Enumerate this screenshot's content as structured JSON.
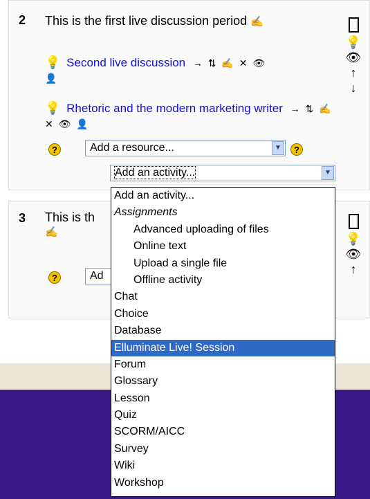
{
  "sections": [
    {
      "number": "2",
      "summary": "This is the first live discussion period",
      "summary_edit_icon": "edit-icon",
      "activities": [
        {
          "title": "Second live discussion",
          "icon": "lightbulb-icon"
        },
        {
          "title": "Rhetoric and the modern marketing writer",
          "icon": "lightbulb-icon"
        }
      ],
      "add_resource_value": "Add a resource...",
      "add_activity_value": "Add an activity..."
    },
    {
      "number": "3",
      "summary": "This is th",
      "add_resource_value": "Ad"
    }
  ],
  "dropdown_options": [
    {
      "label": "Add an activity...",
      "kind": "option"
    },
    {
      "label": "Assignments",
      "kind": "group"
    },
    {
      "label": "Advanced uploading of files",
      "kind": "indented"
    },
    {
      "label": "Online text",
      "kind": "indented"
    },
    {
      "label": "Upload a single file",
      "kind": "indented"
    },
    {
      "label": "Offline activity",
      "kind": "indented"
    },
    {
      "label": "Chat",
      "kind": "option"
    },
    {
      "label": "Choice",
      "kind": "option"
    },
    {
      "label": "Database",
      "kind": "option"
    },
    {
      "label": "Elluminate Live! Session",
      "kind": "option",
      "selected": true
    },
    {
      "label": "Forum",
      "kind": "option"
    },
    {
      "label": "Glossary",
      "kind": "option"
    },
    {
      "label": "Lesson",
      "kind": "option"
    },
    {
      "label": "Quiz",
      "kind": "option"
    },
    {
      "label": "SCORM/AICC",
      "kind": "option"
    },
    {
      "label": "Survey",
      "kind": "option"
    },
    {
      "label": "Wiki",
      "kind": "option"
    },
    {
      "label": "Workshop",
      "kind": "option"
    }
  ],
  "colors": {
    "link": "#1010e0",
    "selection": "#316ac5",
    "footer_purple": "#3a1a86",
    "footer_band": "#ece5d8"
  },
  "icons": {
    "move": "move-right-icon",
    "updown": "move-updown-icon",
    "edit": "edit-icon",
    "delete": "delete-icon",
    "eye": "eye-icon",
    "group": "group-icon",
    "help": "help-icon"
  }
}
